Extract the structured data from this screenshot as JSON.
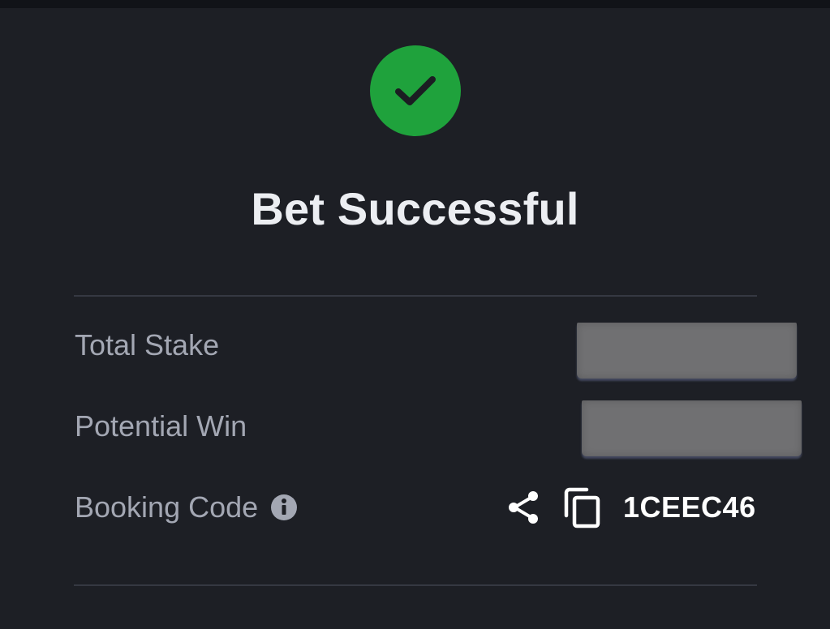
{
  "title": "Bet Successful",
  "status_icon": "checkmark-circle-icon",
  "colors": {
    "background": "#1d1f25",
    "success": "#1fa23c",
    "label": "#a3a7b3",
    "title": "#eceef2",
    "code": "#ffffff"
  },
  "rows": {
    "total_stake": {
      "label": "Total Stake"
    },
    "potential_win": {
      "label": "Potential Win"
    },
    "booking_code": {
      "label": "Booking Code",
      "info_icon": "info-icon",
      "share_icon": "share-icon",
      "copy_icon": "copy-icon",
      "code": "1CEEC46"
    }
  }
}
